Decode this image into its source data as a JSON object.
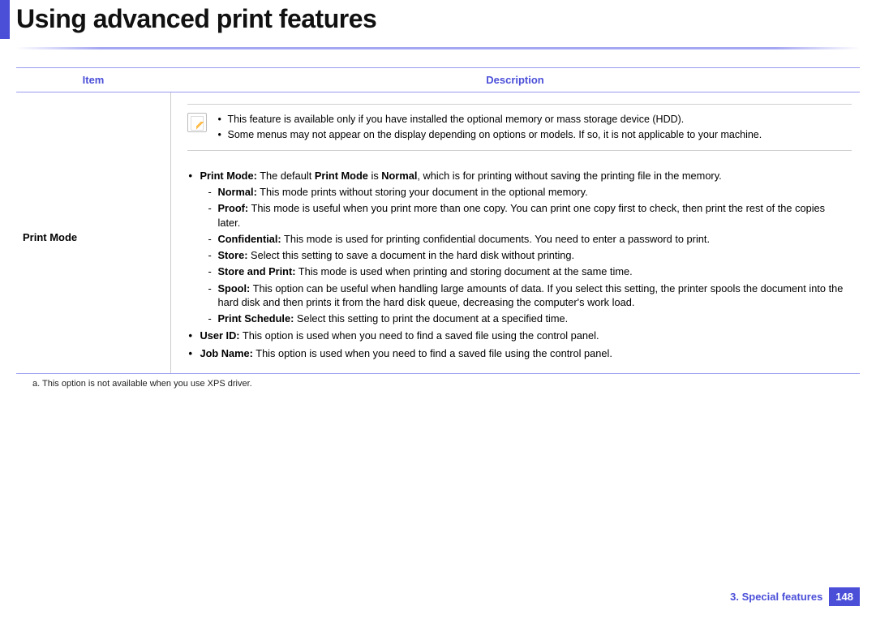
{
  "header": {
    "title": "Using advanced print features"
  },
  "table": {
    "head_item": "Item",
    "head_desc": "Description",
    "item_label": "Print Mode"
  },
  "notes": {
    "n0": "This feature is available only if you have installed the optional memory or mass storage device (HDD).",
    "n1": "Some menus may not appear on the display depending on options or models. If so, it is not applicable to your machine."
  },
  "main": {
    "pm_label": "Print Mode:",
    "pm_text1": " The default ",
    "pm_bold2": "Print Mode",
    "pm_text2": " is ",
    "pm_bold3": "Normal",
    "pm_text3": ", which is for printing without saving the printing file in the memory.",
    "normal_label": "Normal:",
    "normal_text": " This mode prints without storing your document in the optional memory.",
    "proof_label": "Proof:",
    "proof_text": " This mode is useful when you print more than one copy. You can print one copy first to check, then print the rest of the copies later.",
    "conf_label": "Confidential:",
    "conf_text": " This mode is used for printing confidential documents. You need to enter a password to print.",
    "store_label": "Store:",
    "store_text": " Select this setting to save a document in the hard disk without printing.",
    "sp_label": "Store and Print:",
    "sp_text": " This mode is used when printing and storing document at the same time.",
    "spool_label": "Spool:",
    "spool_text": " This option can be useful when handling large amounts of data. If you select this setting, the printer spools the document into the hard disk and then prints it from the hard disk queue, decreasing the computer's work load.",
    "sched_label": "Print Schedule:",
    "sched_text": " Select this setting to print the document at a specified time.",
    "uid_label": "User ID:",
    "uid_text": " This option is used when you need to find a saved file using the control panel.",
    "job_label": "Job Name:",
    "job_text": " This option is used when you need to find a saved file using the control panel."
  },
  "footnote": "a.  This option is not available when you use XPS driver.",
  "footer": {
    "chapter": "3.  Special features",
    "page": "148"
  }
}
